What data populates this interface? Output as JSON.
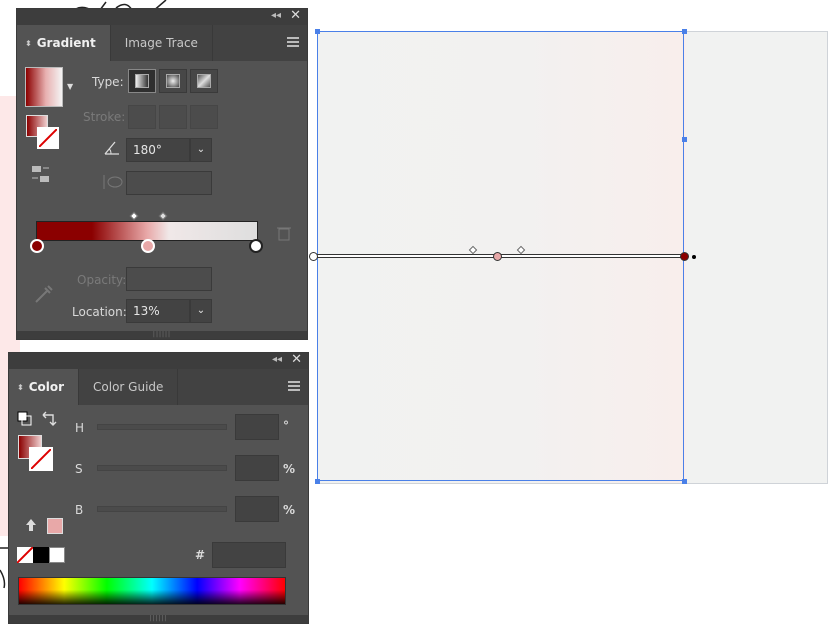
{
  "gradient_panel": {
    "tabs": [
      {
        "label": "Gradient",
        "active": true
      },
      {
        "label": "Image Trace",
        "active": false
      }
    ],
    "type_label": "Type:",
    "stroke_label": "Stroke:",
    "angle_value": "180°",
    "opacity_label": "Opacity:",
    "location_label": "Location:",
    "location_value": "13%",
    "stops": [
      {
        "color": "#8b0000"
      },
      {
        "color": "#e8a8a8"
      },
      {
        "color": "#ffffff"
      }
    ],
    "gradient_colors": {
      "start": "#8b0000",
      "mid": "#f0c8c8",
      "end": "#ffffff"
    }
  },
  "color_panel": {
    "tabs": [
      {
        "label": "Color",
        "active": true
      },
      {
        "label": "Color Guide",
        "active": false
      }
    ],
    "h_label": "H",
    "s_label": "S",
    "b_label": "B",
    "h_unit": "°",
    "s_unit": "%",
    "b_unit": "%",
    "hex_label": "#",
    "current_color": "#e8a8a8"
  },
  "accent": "#4a80e8"
}
